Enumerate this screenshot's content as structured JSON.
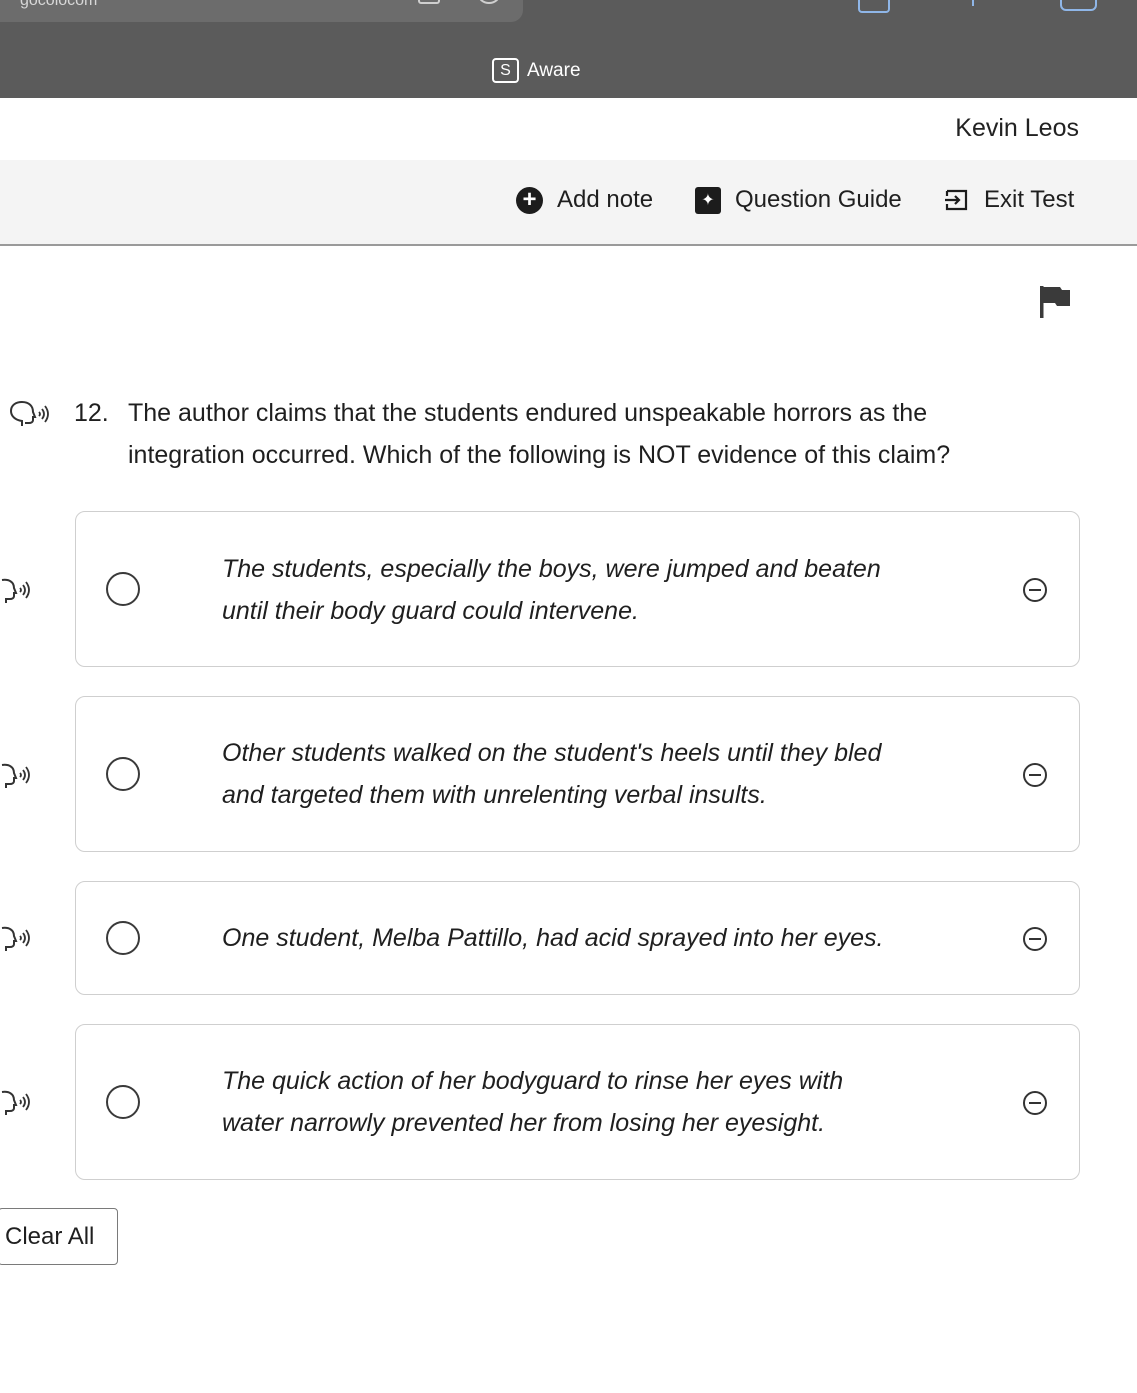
{
  "browser": {
    "url_fragment": "gocolocom",
    "app_name": "Aware",
    "app_logo_letter": "S"
  },
  "user": {
    "name": "Kevin Leos"
  },
  "toolbar": {
    "add_note": "Add note",
    "question_guide": "Question Guide",
    "exit_test": "Exit Test"
  },
  "question": {
    "number": "12.",
    "line1": "The author claims that the students endured unspeakable horrors as the",
    "line2": "integration occurred. Which of the following is NOT evidence of this claim?"
  },
  "options": [
    {
      "line1": "The students, especially the boys, were jumped and beaten",
      "line2": "until their body guard could intervene."
    },
    {
      "line1": "Other students walked on the student's heels until they bled",
      "line2": "and targeted them with unrelenting verbal insults."
    },
    {
      "line1": "One student, Melba Pattillo, had acid sprayed into her eyes.",
      "line2": ""
    },
    {
      "line1": "The quick action of her bodyguard to rinse her eyes with",
      "line2": "water narrowly prevented her from losing her eyesight."
    }
  ],
  "clear_all": "Clear All",
  "icons": {
    "flag": "flag-icon",
    "audio": "text-to-speech-icon",
    "eliminate": "eliminate-option-icon"
  }
}
